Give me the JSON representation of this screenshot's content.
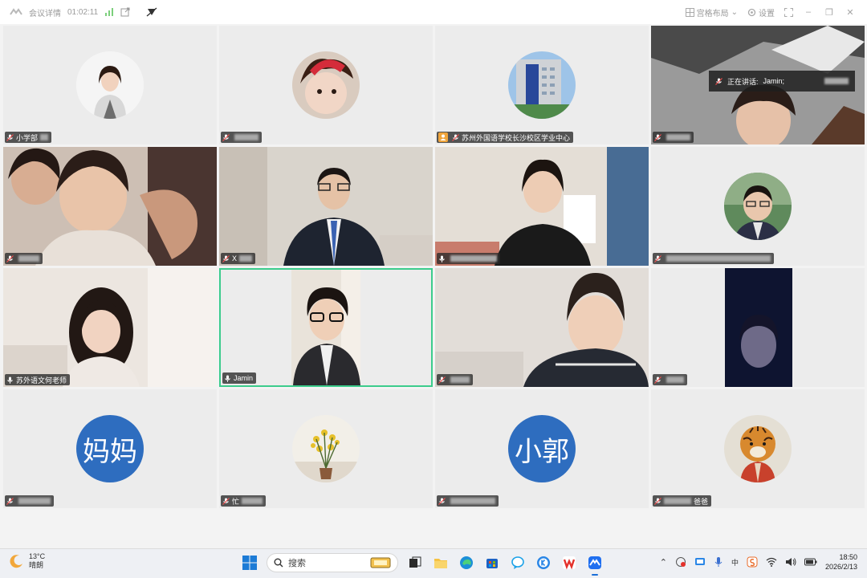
{
  "titlebar": {
    "meeting_details": "会议详情",
    "duration": "01:02:11",
    "layout_label": "宫格布局",
    "settings_label": "设置"
  },
  "speaking": {
    "prefix": "正在讲话:",
    "name": "Jamin;"
  },
  "participants": [
    {
      "name": "小学部"
    },
    {
      "name": ""
    },
    {
      "name": "苏州外国语学校长沙校区学业中心"
    },
    {
      "name": ""
    },
    {
      "name": ""
    },
    {
      "name": "X"
    },
    {
      "name": ""
    },
    {
      "name": ""
    },
    {
      "name": "苏外语文何老师"
    },
    {
      "name": "Jamin"
    },
    {
      "name": ""
    },
    {
      "name": ""
    },
    {
      "name": "",
      "avatar_text": "妈妈"
    },
    {
      "name": "忙"
    },
    {
      "name": "",
      "avatar_text": "小郭"
    },
    {
      "name": "爸爸"
    }
  ],
  "taskbar": {
    "temperature": "13°C",
    "weather": "晴朗",
    "search_placeholder": "搜索",
    "time": "18:50",
    "date": "2026/2/13",
    "ime": "中"
  },
  "colors": {
    "active_border": "#3ccc8c",
    "text_avatar_bg": "#2e6dbf",
    "host_badge": "#f0a43a"
  }
}
